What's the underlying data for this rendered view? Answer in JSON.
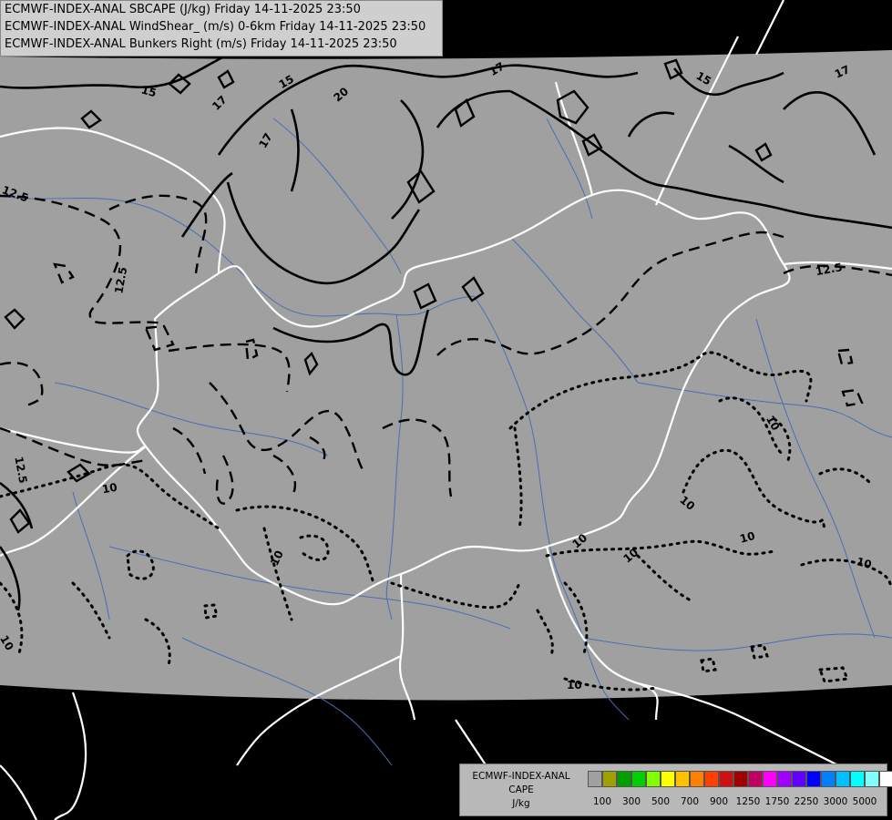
{
  "title_lines": [
    "ECMWF-INDEX-ANAL SBCAPE (J/kg) Friday 14-11-2025 23:50",
    "ECMWF-INDEX-ANAL WindShear_ (m/s) 0-6km Friday 14-11-2025 23:50",
    "ECMWF-INDEX-ANAL Bunkers Right (m/s) Friday 14-11-2025 23:50"
  ],
  "legend": {
    "line1": "ECMWF-INDEX-ANAL",
    "line2": "CAPE",
    "line3": "J/kg",
    "colors": [
      "#a0a0a0",
      "#a0a000",
      "#00a000",
      "#00d000",
      "#80ff00",
      "#ffff00",
      "#ffc000",
      "#ff8000",
      "#ff4000",
      "#d01010",
      "#a00000",
      "#c00060",
      "#ff00ff",
      "#a000ff",
      "#6000ff",
      "#0000ff",
      "#0080ff",
      "#00c0ff",
      "#00ffff",
      "#80ffff",
      "#ffffff"
    ],
    "ticks": [
      "100",
      "300",
      "500",
      "700",
      "900",
      "1250",
      "1750",
      "2250",
      "3000",
      "5000"
    ]
  },
  "map": {
    "background_color": "#000000",
    "domain_color": "#a0a0a0",
    "border_color": "#ffffff",
    "river_color": "#4a6fb0",
    "contour_labels": [
      "15",
      "15",
      "17",
      "20",
      "17",
      "17",
      "15",
      "17",
      "12.5",
      "12.5",
      "12.5",
      "12.5",
      "10",
      "10",
      "10",
      "10",
      "10",
      "10",
      "10",
      "10",
      "10",
      "10"
    ]
  }
}
